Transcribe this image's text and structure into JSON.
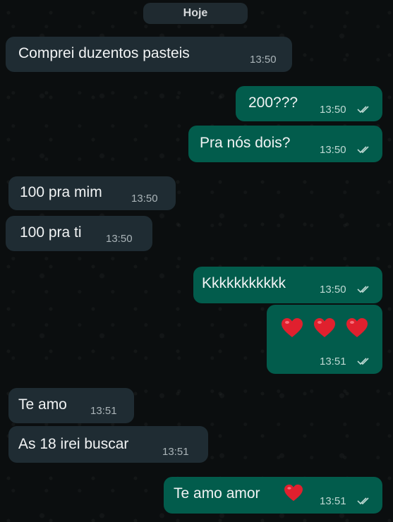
{
  "chat": {
    "date_label": "Hoje",
    "messages": [
      {
        "dir": "in",
        "text": "Comprei duzentos pasteis",
        "time": "13:50"
      },
      {
        "dir": "out",
        "text": "200???",
        "time": "13:50"
      },
      {
        "dir": "out",
        "text": "Pra nós dois?",
        "time": "13:50"
      },
      {
        "dir": "in",
        "text": "100 pra mim",
        "time": "13:50"
      },
      {
        "dir": "in",
        "text": "100 pra ti",
        "time": "13:50"
      },
      {
        "dir": "out",
        "text": "Kkkkkkkkkkk",
        "time": "13:50"
      },
      {
        "dir": "out",
        "text": "",
        "emoji": [
          "heart",
          "heart",
          "heart"
        ],
        "time": "13:51"
      },
      {
        "dir": "in",
        "text": "Te amo",
        "time": "13:51"
      },
      {
        "dir": "in",
        "text": "As 18 irei buscar",
        "time": "13:51"
      },
      {
        "dir": "out",
        "text": "Te amo amor",
        "emoji": [
          "heart"
        ],
        "time": "13:51"
      }
    ]
  },
  "colors": {
    "background": "#0b0e0f",
    "incoming_bubble": "#1f2c33",
    "outgoing_bubble": "#025c4c",
    "heart": "#e0202e"
  }
}
